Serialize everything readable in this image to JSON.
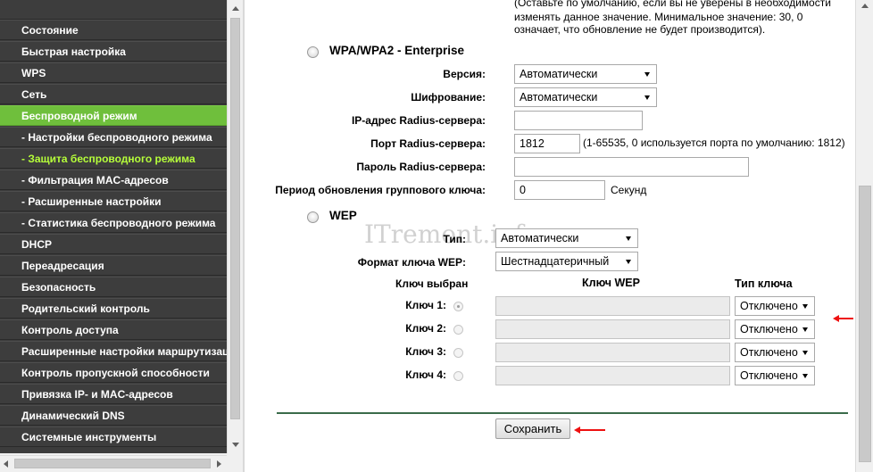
{
  "menu": {
    "items": [
      {
        "label": "Состояние"
      },
      {
        "label": "Быстрая настройка"
      },
      {
        "label": "WPS"
      },
      {
        "label": "Сеть"
      },
      {
        "label": "Беспроводной режим"
      },
      {
        "label": "- Настройки беспроводного режима"
      },
      {
        "label": "- Защита беспроводного режима"
      },
      {
        "label": "- Фильтрация MAC-адресов"
      },
      {
        "label": "- Расширенные настройки"
      },
      {
        "label": "- Статистика беспроводного режима"
      },
      {
        "label": "DHCP"
      },
      {
        "label": "Переадресация"
      },
      {
        "label": "Безопасность"
      },
      {
        "label": "Родительский контроль"
      },
      {
        "label": "Контроль доступа"
      },
      {
        "label": "Расширенные настройки маршрутизации"
      },
      {
        "label": "Контроль пропускной способности"
      },
      {
        "label": "Привязка IP- и MAC-адресов"
      },
      {
        "label": "Динамический DNS"
      },
      {
        "label": "Системные инструменты"
      }
    ],
    "active_item": "Беспроводной режим",
    "active_subitem": "- Защита беспроводного режима",
    "active_color": "#6fbf3c",
    "active_sub_color": "#b6ff3a"
  },
  "top_note": {
    "line1": "(Оставьте по умолчанию, если вы не уверены в необходимости",
    "line2": "изменять данное значение. Минимальное значение: 30, 0",
    "line3": "означает, что обновление не будет производится)."
  },
  "enterprise": {
    "title": "WPA/WPA2 - Enterprise",
    "version_label": "Версия:",
    "version_value": "Автоматически",
    "encryption_label": "Шифрование:",
    "encryption_value": "Автоматически",
    "radius_ip_label": "IP-адрес Radius-сервера:",
    "radius_ip_value": "",
    "radius_port_label": "Порт Radius-сервера:",
    "radius_port_value": "1812",
    "radius_port_note": "(1-65535, 0 используется порта по умолчанию: 1812)",
    "radius_password_label": "Пароль Radius-сервера:",
    "radius_password_value": "",
    "group_key_label": "Период обновления группового ключа:",
    "group_key_value": "0",
    "group_key_unit": "Секунд"
  },
  "wep": {
    "title": "WEP",
    "type_label": "Тип:",
    "type_value": "Автоматически",
    "format_label": "Формат ключа WEP:",
    "format_value": "Шестнадцатеричный",
    "col_selected": "Ключ выбран",
    "col_key": "Ключ WEP",
    "col_type": "Тип ключа",
    "keys": [
      {
        "label": "Ключ 1:",
        "value": "",
        "type": "Отключено",
        "selected": true
      },
      {
        "label": "Ключ 2:",
        "value": "",
        "type": "Отключено",
        "selected": false
      },
      {
        "label": "Ключ 3:",
        "value": "",
        "type": "Отключено",
        "selected": false
      },
      {
        "label": "Ключ 4:",
        "value": "",
        "type": "Отключено",
        "selected": false
      }
    ]
  },
  "watermark": "ITremont.info",
  "save_label": "Сохранить",
  "colors": {
    "menu_bg": "#3d3d3d",
    "annotation_arrow": "#e11111",
    "divider": "#3a6b4a"
  }
}
